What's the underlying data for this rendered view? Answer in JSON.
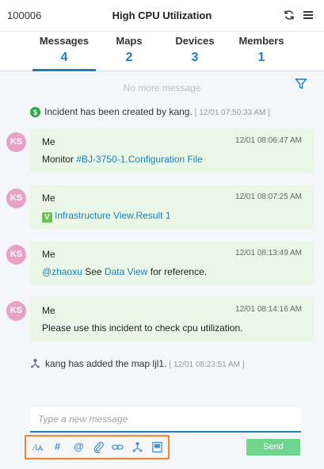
{
  "header": {
    "incident_id": "100006",
    "title": "High CPU Utilization",
    "refresh_icon": "refresh-icon",
    "menu_icon": "hamburger-menu-icon"
  },
  "tabs": [
    {
      "label": "Messages",
      "count": "4",
      "active": true
    },
    {
      "label": "Maps",
      "count": "2",
      "active": false
    },
    {
      "label": "Devices",
      "count": "3",
      "active": false
    },
    {
      "label": "Members",
      "count": "1",
      "active": false
    }
  ],
  "feed": {
    "no_more": "No more message",
    "filter_icon": "filter-icon",
    "created_event": {
      "icon": "dollar-circle-icon",
      "text": "Incident has been created by kang.",
      "timestamp": "[ 12/01 07:50:33 AM ]"
    },
    "messages": [
      {
        "avatar": "KS",
        "sender": "Me",
        "time": "12/01 08:06:47 AM",
        "prefix": "Monitor ",
        "link": "#BJ-3750-1.Configuration File",
        "suffix": ""
      },
      {
        "avatar": "KS",
        "sender": "Me",
        "time": "12/01 08:07:25 AM",
        "badge": "V",
        "link": "Infrastructure View.Result 1"
      },
      {
        "avatar": "KS",
        "sender": "Me",
        "time": "12/01 08:13:49 AM",
        "mention": "@zhaoxu",
        "middle": " See ",
        "link": "Data View",
        "suffix": " for reference."
      },
      {
        "avatar": "KS",
        "sender": "Me",
        "time": "12/01 08:14:16 AM",
        "text": "Please use this incident to check cpu utilization."
      }
    ],
    "map_event": {
      "icon": "map-node-icon",
      "text": "kang has added the map ljl1.",
      "timestamp": "[ 12/01 08:23:51 AM ]"
    }
  },
  "composer": {
    "placeholder": "Type a new message",
    "send_label": "Send",
    "toolbar": [
      {
        "icon": "text-format-icon"
      },
      {
        "icon": "hashtag-icon",
        "glyph": "#"
      },
      {
        "icon": "mention-icon",
        "glyph": "@"
      },
      {
        "icon": "attachment-icon"
      },
      {
        "icon": "link-icon"
      },
      {
        "icon": "map-icon"
      },
      {
        "icon": "snapshot-icon"
      }
    ]
  },
  "colors": {
    "accent": "#1a7fbf",
    "message_bg": "#eaf7e6",
    "avatar_bg": "#e8a3c4",
    "send_bg": "#6fd48e",
    "toolbar_outline": "#f5822a"
  }
}
